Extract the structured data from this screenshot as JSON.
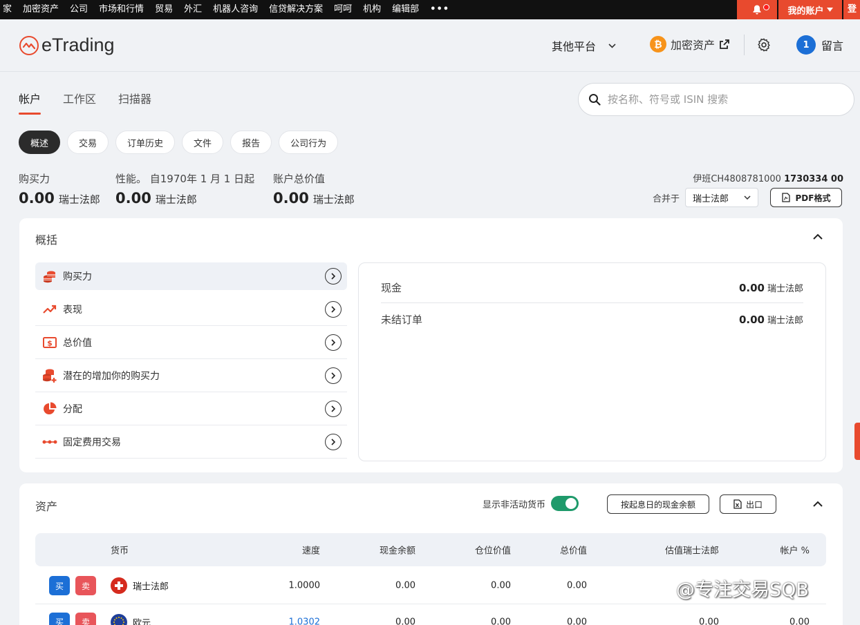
{
  "topnav": {
    "items": [
      "家",
      "加密资产",
      "公司",
      "市场和行情",
      "贸易",
      "外汇",
      "机器人咨询",
      "信贷解决方案",
      "呵呵",
      "机构",
      "编辑部",
      "•••"
    ],
    "account": "我的账户",
    "login": "登"
  },
  "header": {
    "logo": "eTrading",
    "other_platform": "其他平台",
    "crypto": "加密资产",
    "message_count": "1",
    "message": "留言"
  },
  "tabs": [
    "帐户",
    "工作区",
    "扫描器"
  ],
  "search": {
    "placeholder": "按名称、符号或 ISIN 搜索"
  },
  "pills": [
    "概述",
    "交易",
    "订单历史",
    "文件",
    "报告",
    "公司行为"
  ],
  "stats": {
    "buying_power": {
      "label": "购买力",
      "value": "0.00",
      "currency": "瑞士法郎"
    },
    "performance": {
      "label": "性能。 自1970年 1 月 1 日起",
      "value": "0.00",
      "currency": "瑞士法郎"
    },
    "total_value": {
      "label": "账户总价值",
      "value": "0.00",
      "currency": "瑞士法郎"
    }
  },
  "account_info": {
    "iban_label": "伊班CH4808781000",
    "iban_number": "1730334 00",
    "merge_label": "合并于",
    "merge_currency": "瑞士法郎",
    "pdf_button": "PDF格式"
  },
  "summary": {
    "title": "概括",
    "menu": [
      {
        "label": "购买力",
        "icon": "coins-icon"
      },
      {
        "label": "表现",
        "icon": "trend-up-icon"
      },
      {
        "label": "总价值",
        "icon": "dollar-bill-icon"
      },
      {
        "label": "潜在的增加你的购买力",
        "icon": "coins-plus-icon"
      },
      {
        "label": "分配",
        "icon": "pie-chart-icon"
      },
      {
        "label": "固定费用交易",
        "icon": "dots-line-icon"
      }
    ],
    "details": [
      {
        "label": "现金",
        "value": "0.00",
        "currency": "瑞士法郎"
      },
      {
        "label": "未结订单",
        "value": "0.00",
        "currency": "瑞士法郎"
      }
    ]
  },
  "assets": {
    "title": "资产",
    "toggle_label": "显示非活动货币",
    "cash_by_value_date": "按起息日的现金余额",
    "export": "出口",
    "columns": [
      "货币",
      "速度",
      "现金余额",
      "仓位价值",
      "总价值",
      "估值瑞士法郎",
      "帐户 %"
    ],
    "buy_label": "买",
    "sell_label": "卖",
    "rows": [
      {
        "currency": "瑞士法郎",
        "rate": "1.0000",
        "cash": "0.00",
        "position": "0.00",
        "total": "0.00",
        "valuation": "",
        "pct": ""
      },
      {
        "currency": "欧元",
        "rate": "1.0302",
        "cash": "0.00",
        "position": "0.00",
        "total": "0.00",
        "valuation": "0.00",
        "pct": "0.00"
      }
    ]
  },
  "colors": {
    "accent": "#e84a2e",
    "dark": "#111111",
    "link": "#1c6fd6",
    "toggle": "#1f9a6b"
  },
  "watermark": "@专注交易SQB"
}
